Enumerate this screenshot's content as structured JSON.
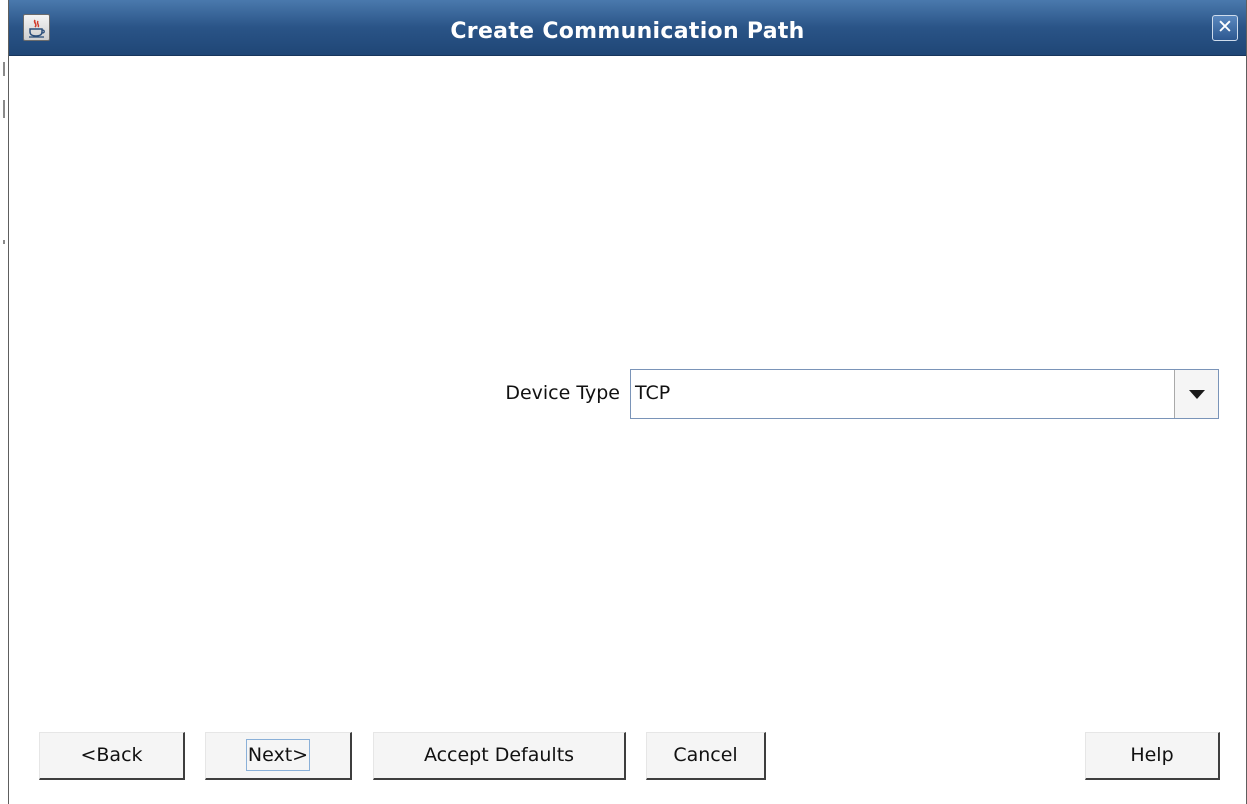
{
  "window": {
    "title": "Create Communication Path",
    "close_glyph": "✕"
  },
  "form": {
    "device_type_label": "Device Type",
    "device_type_value": "TCP"
  },
  "buttons": {
    "back": "<Back",
    "next": "Next>",
    "accept_defaults": "Accept Defaults",
    "cancel": "Cancel",
    "help": "Help"
  },
  "icons": {
    "app": "java-coffee-cup-icon",
    "close": "close-icon",
    "dropdown": "chevron-down-icon"
  },
  "colors": {
    "titlebar": "#2a5487",
    "title_text": "#ffffff",
    "focus_ring": "#8ab0d8"
  }
}
